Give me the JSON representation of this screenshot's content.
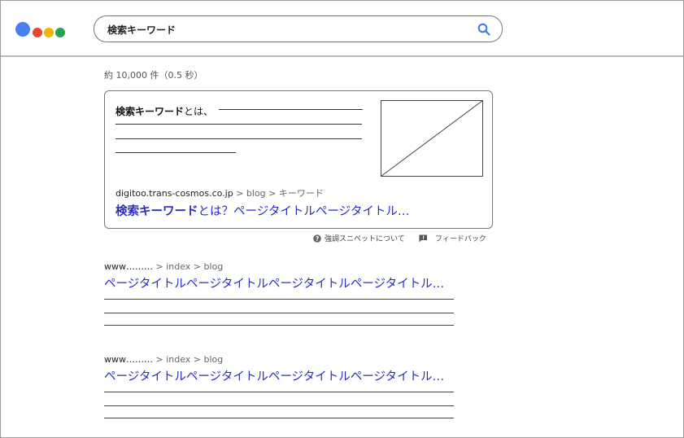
{
  "search": {
    "query": "検索キーワード"
  },
  "results_stats": "約 10,000 件（0.5 秒）",
  "snippet": {
    "heading_bold": "検索キーワード",
    "heading_suffix": "とは、",
    "url": {
      "domain": "digitoo.trans-cosmos.co.jp",
      "path": "> blog > キーワード"
    },
    "title_bold": "検索キーワード",
    "title_rest": "とは？ページタイトルページタイトル…"
  },
  "snippet_footer": {
    "about_label": "強調スニペットについて",
    "feedback_label": "フィードバック"
  },
  "results": [
    {
      "domain": "www………",
      "path": "> index > blog",
      "title": "ページタイトルページタイトルページタイトルページタイトル…"
    },
    {
      "domain": "www………",
      "path": "> index > blog",
      "title": "ページタイトルページタイトルページタイトルページタイトル…"
    }
  ],
  "colors": {
    "link": "#2c2cc4",
    "logo_blue": "#4a7ff3",
    "logo_red": "#e54734",
    "logo_yellow": "#f4b400",
    "logo_green": "#2aa24e",
    "search_icon": "#3b78e7"
  },
  "icons": {
    "logo": "four-colored-dots",
    "search": "magnifier-icon",
    "help": "question-circle-icon",
    "feedback": "flag-icon"
  }
}
